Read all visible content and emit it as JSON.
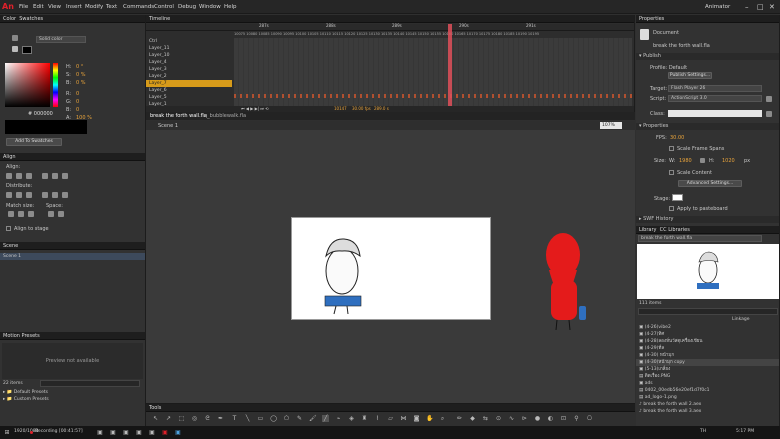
{
  "menu": {
    "logo": "An",
    "items": [
      "File",
      "Edit",
      "View",
      "Insert",
      "Modify",
      "Text",
      "Commands",
      "Control",
      "Debug",
      "Window",
      "Help"
    ],
    "workspace": "Animator"
  },
  "color_panel": {
    "tabs": [
      "Color",
      "Swatches"
    ],
    "mode": "Solid color",
    "fields": [
      {
        "label": "H:",
        "value": "0 °"
      },
      {
        "label": "S:",
        "value": "0 %"
      },
      {
        "label": "B:",
        "value": "0 %"
      },
      {
        "label": "R:",
        "value": "0"
      },
      {
        "label": "G:",
        "value": "0"
      },
      {
        "label": "B:",
        "value": "0"
      },
      {
        "label": "A:",
        "value": "100 %"
      }
    ],
    "hex": "# 000000",
    "add_button": "Add To Swatches"
  },
  "align_panel": {
    "title": "Align",
    "align": "Align:",
    "distribute": "Distribute:",
    "match_size": "Match size:",
    "space": "Space:",
    "align_to_stage": "Align to stage"
  },
  "scene_panel": {
    "title": "Scene",
    "scene": "Scene 1"
  },
  "motion_panel": {
    "title": "Motion Presets",
    "preview": "Preview not available",
    "count": "22 items",
    "items": [
      "Default Presets",
      "Custom Presets"
    ]
  },
  "timeline": {
    "title": "Timeline",
    "layers": [
      "Ctrl",
      "Layer_11",
      "Layer_10",
      "Layer_4",
      "Layer_3",
      "Layer_2",
      "Layer_7",
      "Layer_6",
      "Layer_5",
      "Layer_1"
    ],
    "active_layer_index": 6,
    "ruler": [
      "287s",
      "288s",
      "289s",
      "290s",
      "291s"
    ],
    "ruler_numbers": "10075 10080 10085 10090 10095 10100 10105 10110 10115 10120 10125 10130 10135 10140 10145 10150 10155 10160 10165 10170 10175 10180 10185 10190 10195",
    "frame_info": [
      "10147",
      "30.00 fps",
      "289.0 s"
    ]
  },
  "document": {
    "tabs": [
      "break the forth wall.fla",
      "q_bubblewalk.fla"
    ],
    "scene": "Scene 1",
    "zoom": "107%"
  },
  "properties": {
    "title": "Properties",
    "doc_label": "Document",
    "doc_name": "break the forth wall.fla",
    "publish": "Publish",
    "profile": "Profile: Default",
    "publish_settings": "Publish Settings...",
    "target_label": "Target:",
    "target": "Flash Player 26",
    "script_label": "Script:",
    "script": "ActionScript 3.0",
    "class_label": "Class:",
    "props": "Properties",
    "fps_label": "FPS:",
    "fps": "30.00",
    "scale_frame_spans": "Scale Frame Spans",
    "size_label": "Size:",
    "w_label": "W:",
    "w": "1980",
    "h_label": "H:",
    "h": "1020",
    "px": "px",
    "scale_content": "Scale Content",
    "advanced": "Advanced Settings...",
    "stage_label": "Stage:",
    "apply": "Apply to pasteboard",
    "swf_history": "SWF History"
  },
  "library": {
    "tabs": [
      "Library",
      "CC Libraries"
    ],
    "doc": "break the forth wall.fla",
    "count": "111 items",
    "linkage": "Linkage",
    "items": [
      "(4-26)vibe2",
      "(4-27)ทิศ",
      "(4-28)ลองหั่นวัสดุเครื่องเขียน",
      "(4-29)ที่ล",
      "(4-30) หน้ามุก",
      "(4-30)หน้ามุก copy",
      "(5-13)เกลี่ยง",
      "ติดเรื่อง.PNG",
      "ads",
      "0402_00edb56e20ef1d7f0c1",
      "ad_logo-1.png",
      "break the forth wall 2.aex",
      "break the forth wall 3.aex"
    ]
  },
  "tools": {
    "title": "Tools"
  },
  "taskbar": {
    "recording": "Recording [00:41:57]",
    "resolution": "1920/1080",
    "lang": "TH",
    "time": "5:17 PM"
  },
  "colors": {
    "accent_red": "#e0202a",
    "active_layer": "#d79b1a",
    "stage": "#ffffff",
    "pasteboard": "#3a3a3a"
  }
}
